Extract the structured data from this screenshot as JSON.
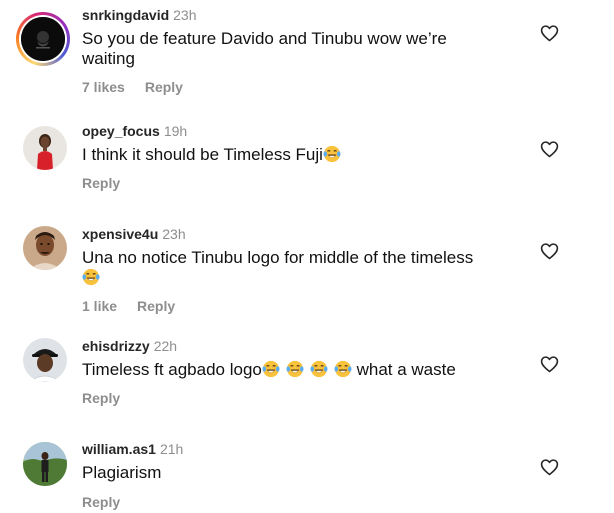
{
  "comments": [
    {
      "username": "snrkingdavid",
      "time": "23h",
      "text": "So you de feature Davido and Tinubu wow we’re waiting",
      "likes": "7 likes",
      "reply": "Reply",
      "avatar": "dark-logo-avatar"
    },
    {
      "username": "opey_focus",
      "time": "19h",
      "text": "I think it should be Timeless Fuji",
      "emoji": "laughing-crying-emoji",
      "reply": "Reply",
      "avatar": "woman-red-dress-avatar"
    },
    {
      "username": "xpensive4u",
      "time": "23h",
      "text": "Una no notice Tinubu logo for middle of the timeless",
      "emoji": "laughing-crying-emoji",
      "likes": "1 like",
      "reply": "Reply",
      "avatar": "man-portrait-avatar"
    },
    {
      "username": "ehisdrizzy",
      "time": "22h",
      "text_before": "Timeless ft agbado logo",
      "text_after": " what a waste",
      "emoji": "laughing-crying-emoji",
      "emoji_count": 4,
      "reply": "Reply",
      "avatar": "man-cap-avatar"
    },
    {
      "username": "william.as1",
      "time": "21h",
      "text": "Plagiarism",
      "reply": "Reply",
      "avatar": "man-outdoor-avatar"
    }
  ],
  "colors": {
    "username": "#262626",
    "secondary": "#8e8e8e",
    "text": "#111111"
  },
  "icons": {
    "like": "heart-outline-icon"
  }
}
